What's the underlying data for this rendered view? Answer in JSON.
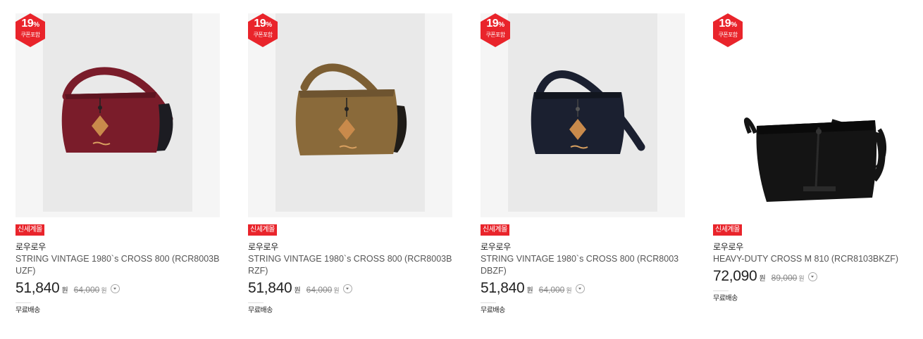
{
  "products": [
    {
      "discount": {
        "value": "19",
        "unit": "%",
        "label": "쿠폰포함"
      },
      "tag": "신세계몰",
      "brand": "로우로우",
      "name": "STRING VINTAGE 1980`s CROSS 800 (RCR8003BUZF)",
      "price": "51,840",
      "price_unit": "원",
      "original_price": "64,000",
      "original_unit": "원",
      "shipping": "무료배송",
      "bag_color": "#7a1c2a"
    },
    {
      "discount": {
        "value": "19",
        "unit": "%",
        "label": "쿠폰포함"
      },
      "tag": "신세계몰",
      "brand": "로우로우",
      "name": "STRING VINTAGE 1980`s CROSS 800 (RCR8003BRZF)",
      "price": "51,840",
      "price_unit": "원",
      "original_price": "64,000",
      "original_unit": "원",
      "shipping": "무료배송",
      "bag_color": "#8a6a3a"
    },
    {
      "discount": {
        "value": "19",
        "unit": "%",
        "label": "쿠폰포함"
      },
      "tag": "신세계몰",
      "brand": "로우로우",
      "name": "STRING VINTAGE 1980`s CROSS 800 (RCR8003DBZF)",
      "price": "51,840",
      "price_unit": "원",
      "original_price": "64,000",
      "original_unit": "원",
      "shipping": "무료배송",
      "bag_color": "#1b2030"
    },
    {
      "discount": {
        "value": "19",
        "unit": "%",
        "label": "쿠폰포함"
      },
      "tag": "신세계몰",
      "brand": "로우로우",
      "name": "HEAVY-DUTY CROSS M 810 (RCR8103BKZF)",
      "price": "72,090",
      "price_unit": "원",
      "original_price": "89,000",
      "original_unit": "원",
      "shipping": "무료배송",
      "bag_color": "#141414"
    }
  ],
  "colors": {
    "badge_red": "#e9242b",
    "patch_brown": "#c98a4b"
  }
}
